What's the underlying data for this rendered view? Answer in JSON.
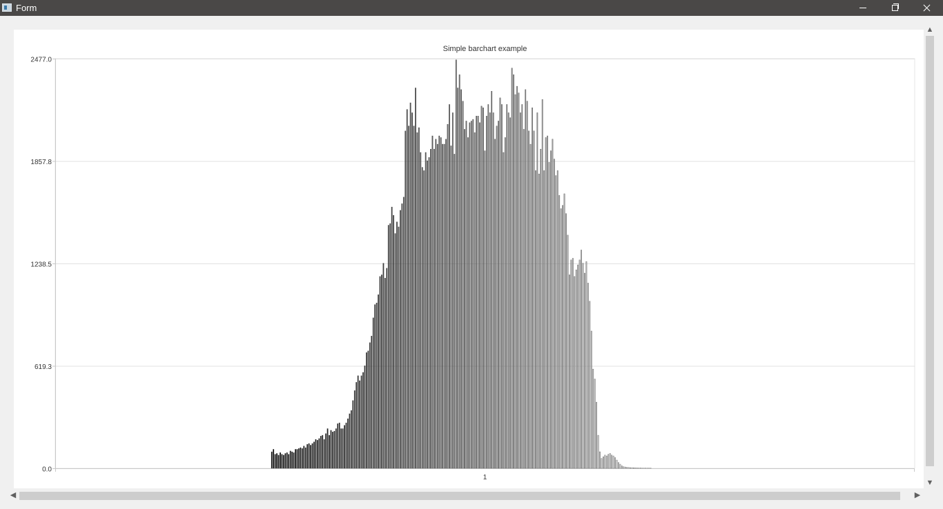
{
  "window": {
    "title": "Form",
    "icons": {
      "app": "app-window-icon",
      "minimize": "minimize-icon",
      "maximize": "restore-icon",
      "close": "close-icon"
    }
  },
  "scrollbars": {
    "up_arrow": "▲",
    "down_arrow": "▼",
    "left_arrow": "◀",
    "right_arrow": "▶"
  },
  "chart_data": {
    "type": "bar",
    "title": "Simple barchart example",
    "categories": [
      "1"
    ],
    "ylim": [
      0,
      2477.0
    ],
    "yticks": [
      "0.0",
      "619.3",
      "1238.5",
      "1857.8",
      "2477.0"
    ],
    "grid": true,
    "legend": "none",
    "colors": {
      "first_bar": "#000000",
      "last_bar": "#ffffff",
      "grid": "#e0e0e0",
      "axis": "#c8c8c8"
    },
    "values": [
      100,
      115,
      85,
      90,
      80,
      95,
      85,
      80,
      90,
      95,
      85,
      105,
      100,
      95,
      115,
      115,
      120,
      125,
      120,
      135,
      125,
      145,
      150,
      140,
      150,
      160,
      175,
      170,
      180,
      195,
      200,
      175,
      210,
      240,
      200,
      230,
      220,
      225,
      240,
      270,
      275,
      240,
      240,
      260,
      275,
      300,
      330,
      350,
      410,
      470,
      520,
      560,
      530,
      560,
      580,
      620,
      700,
      710,
      760,
      800,
      910,
      990,
      1000,
      1050,
      1160,
      1170,
      1240,
      1150,
      1210,
      1470,
      1480,
      1580,
      1530,
      1420,
      1490,
      1460,
      1560,
      1600,
      1640,
      2040,
      2170,
      2070,
      2210,
      2150,
      2070,
      2300,
      2030,
      2060,
      1910,
      1820,
      1800,
      1910,
      1860,
      1880,
      1930,
      2010,
      1930,
      1990,
      1960,
      2010,
      2000,
      1960,
      1960,
      1990,
      2080,
      2200,
      1950,
      2150,
      1900,
      2470,
      2300,
      2380,
      2290,
      2220,
      2050,
      2100,
      2000,
      2090,
      2100,
      2110,
      2030,
      2130,
      2130,
      2090,
      2190,
      2180,
      1920,
      2130,
      2200,
      2150,
      2280,
      2150,
      1990,
      2070,
      2100,
      2240,
      2200,
      1910,
      2000,
      2200,
      2150,
      2120,
      2420,
      2380,
      2260,
      2310,
      2270,
      2150,
      2200,
      2050,
      2290,
      2220,
      2040,
      1960,
      2180,
      2040,
      1800,
      2150,
      1780,
      1930,
      2230,
      1800,
      2000,
      2010,
      1850,
      1920,
      1990,
      1870,
      1770,
      1800,
      1650,
      1570,
      1590,
      1660,
      1540,
      1410,
      1170,
      1260,
      1270,
      1160,
      1200,
      1230,
      1260,
      1320,
      1240,
      1180,
      1250,
      1120,
      1010,
      830,
      600,
      540,
      400,
      200,
      100,
      60,
      70,
      80,
      75,
      85,
      90,
      80,
      75,
      65,
      50,
      35,
      25,
      15,
      10,
      8,
      6,
      5,
      4,
      4,
      3,
      3,
      2,
      2,
      2,
      1,
      1,
      1,
      1,
      1,
      1,
      0,
      0,
      0,
      0,
      0,
      0,
      0,
      0,
      0,
      0,
      0,
      0,
      0,
      0,
      0,
      0,
      0,
      0,
      0,
      0,
      0,
      0,
      0,
      0,
      0,
      0,
      0,
      0
    ]
  }
}
